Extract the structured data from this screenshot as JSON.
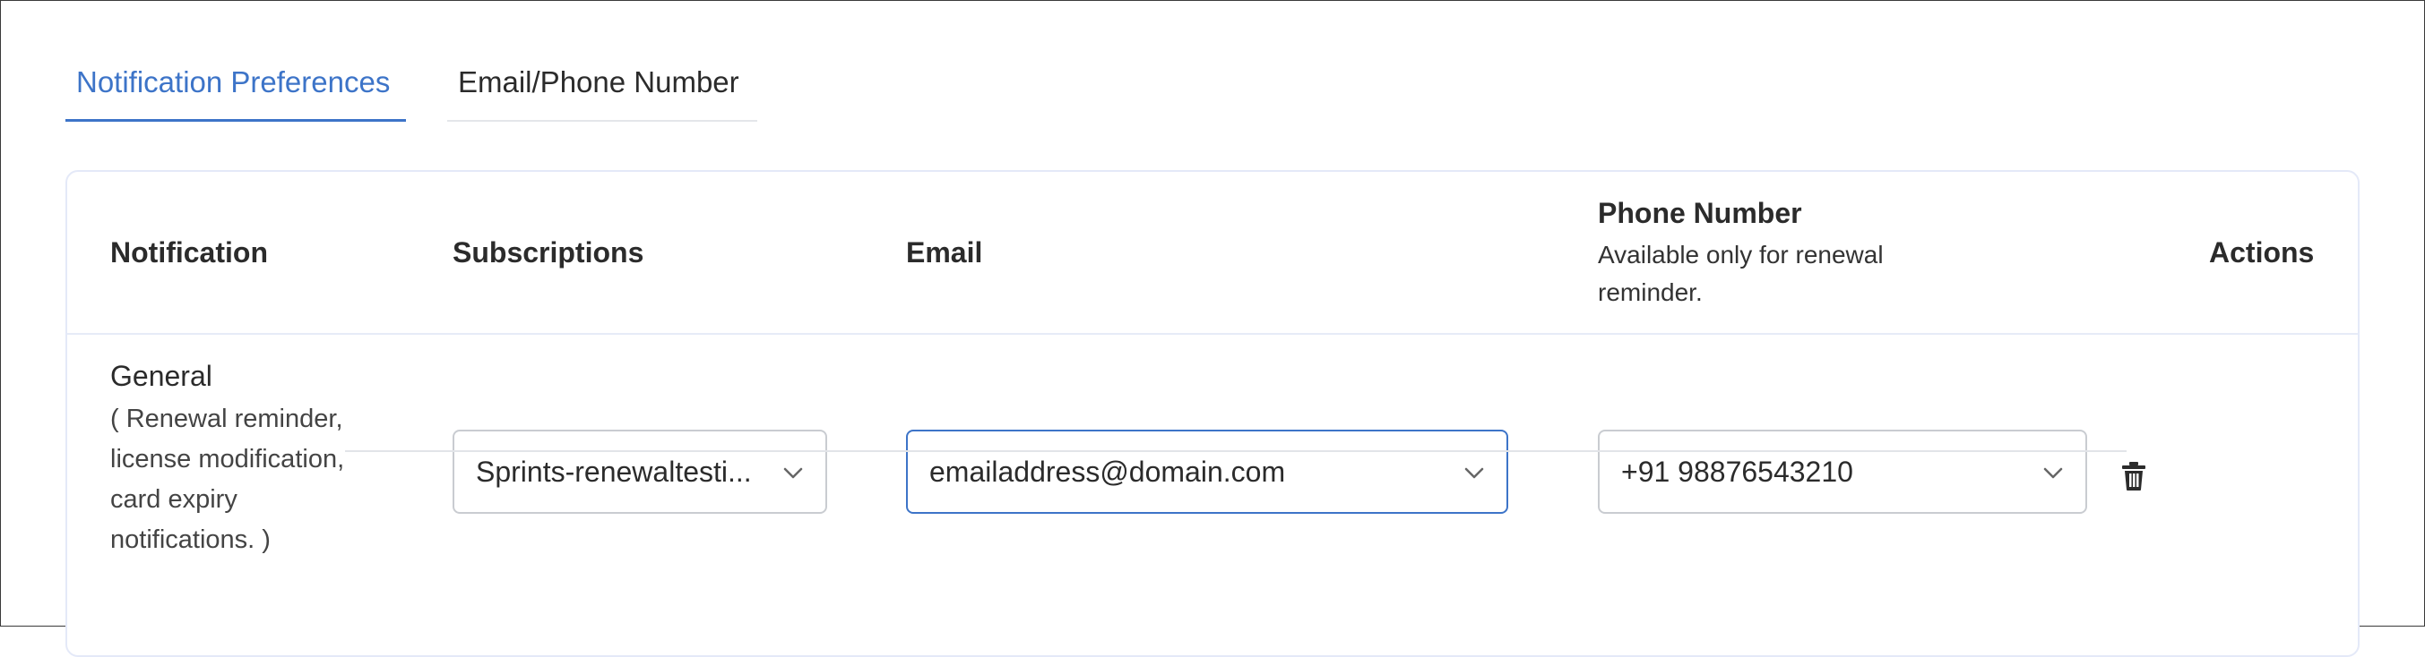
{
  "tabs": [
    {
      "label": "Notification Preferences",
      "active": true
    },
    {
      "label": "Email/Phone Number",
      "active": false
    }
  ],
  "table": {
    "headers": {
      "notification": "Notification",
      "subscriptions": "Subscriptions",
      "email": "Email",
      "phone": "Phone Number",
      "phone_note": "Available only for renewal reminder.",
      "actions": "Actions"
    },
    "rows": [
      {
        "notification_title": "General",
        "notification_desc": "( Renewal reminder, license modification, card expiry notifications. )",
        "subscription": "Sprints-renewaltesti...",
        "email": "emailaddress@domain.com",
        "phone": "+91 98876543210",
        "delete_icon": "trash-icon"
      }
    ]
  },
  "colors": {
    "accent": "#3d74c8",
    "border": "#c9ccd1",
    "card_border": "#e4e9f8"
  }
}
